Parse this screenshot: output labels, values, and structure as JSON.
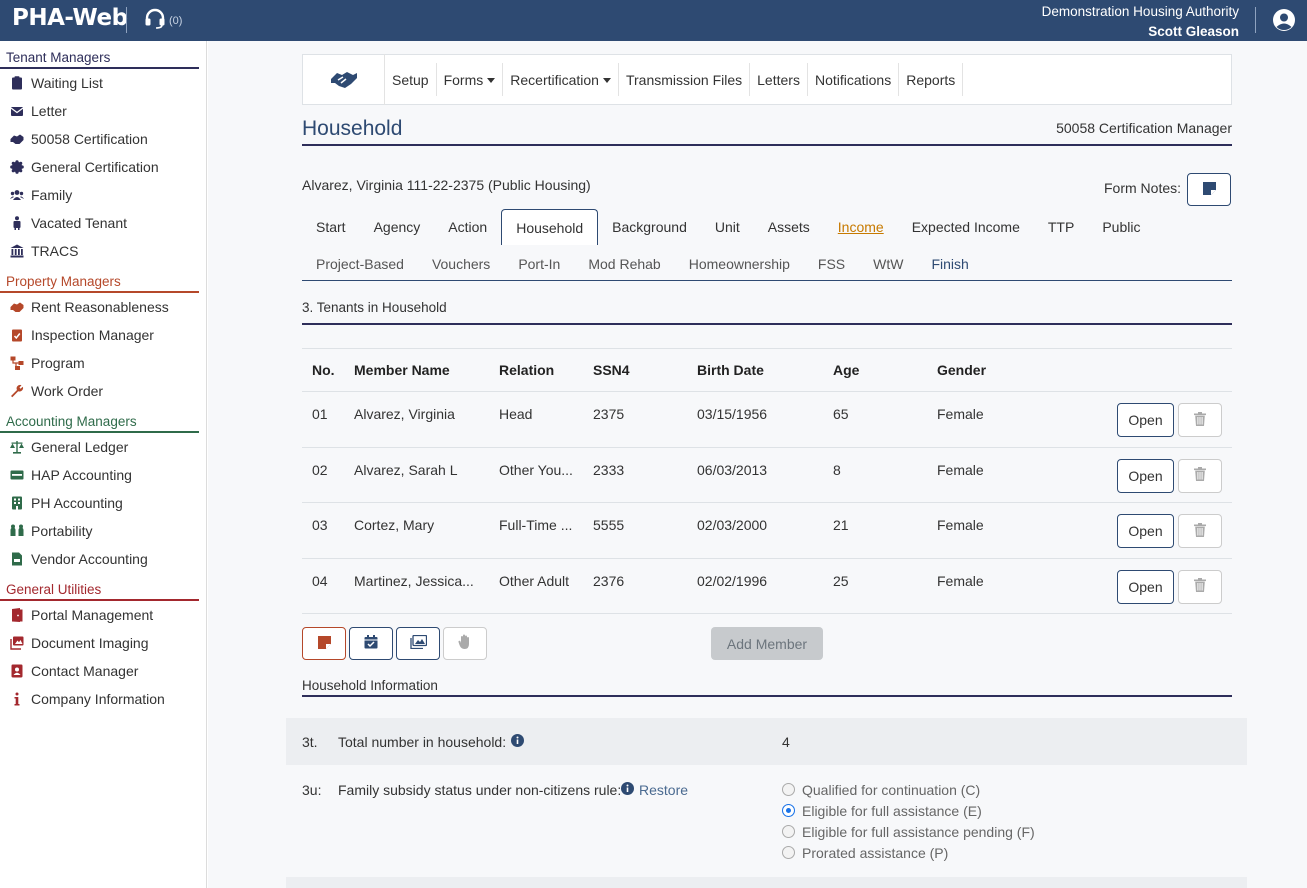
{
  "header": {
    "app_name": "PHA-Web",
    "support_count": "(0)",
    "organization": "Demonstration Housing Authority",
    "user": "Scott Gleason"
  },
  "sidebar": {
    "sections": [
      {
        "title": "Tenant Managers",
        "color": "#2e2e5a",
        "items": [
          {
            "label": "Waiting List",
            "icon": "clipboard-icon"
          },
          {
            "label": "Letter",
            "icon": "envelope-icon"
          },
          {
            "label": "50058 Certification",
            "icon": "handshake-icon"
          },
          {
            "label": "General Certification",
            "icon": "certificate-icon"
          },
          {
            "label": "Family",
            "icon": "users-icon"
          },
          {
            "label": "Vacated Tenant",
            "icon": "person-luggage-icon"
          },
          {
            "label": "TRACS",
            "icon": "building-columns-icon"
          }
        ]
      },
      {
        "title": "Property Managers",
        "color": "#b5482a",
        "items": [
          {
            "label": "Rent Reasonableness",
            "icon": "handshake-icon"
          },
          {
            "label": "Inspection Manager",
            "icon": "clipboard-check-icon"
          },
          {
            "label": "Program",
            "icon": "sitemap-icon"
          },
          {
            "label": "Work Order",
            "icon": "wrench-icon"
          }
        ]
      },
      {
        "title": "Accounting Managers",
        "color": "#2f6b4a",
        "items": [
          {
            "label": "General Ledger",
            "icon": "scale-icon"
          },
          {
            "label": "HAP Accounting",
            "icon": "money-bill-icon"
          },
          {
            "label": "PH Accounting",
            "icon": "building-icon"
          },
          {
            "label": "Portability",
            "icon": "people-arrows-icon"
          },
          {
            "label": "Vendor Accounting",
            "icon": "file-invoice-icon"
          }
        ]
      },
      {
        "title": "General Utilities",
        "color": "#a3282e",
        "items": [
          {
            "label": "Portal Management",
            "icon": "door-icon"
          },
          {
            "label": "Document Imaging",
            "icon": "images-icon"
          },
          {
            "label": "Contact Manager",
            "icon": "address-book-icon"
          },
          {
            "label": "Company Information",
            "icon": "info-icon"
          }
        ]
      }
    ]
  },
  "menubar": {
    "items": [
      {
        "label": "Setup"
      },
      {
        "label": "Forms",
        "dropdown": true
      },
      {
        "label": "Recertification",
        "dropdown": true
      },
      {
        "label": "Transmission Files"
      },
      {
        "label": "Letters"
      },
      {
        "label": "Notifications"
      },
      {
        "label": "Reports"
      }
    ]
  },
  "page": {
    "title": "Household",
    "subtitle": "50058 Certification Manager",
    "tenant": "Alvarez, Virginia 111-22-2375 (Public Housing)",
    "form_notes_label": "Form Notes:"
  },
  "tabs_row1": [
    {
      "label": "Start"
    },
    {
      "label": "Agency"
    },
    {
      "label": "Action"
    },
    {
      "label": "Household",
      "active": true
    },
    {
      "label": "Background"
    },
    {
      "label": "Unit"
    },
    {
      "label": "Assets"
    },
    {
      "label": "Income",
      "warning": true
    },
    {
      "label": "Expected Income"
    },
    {
      "label": "TTP"
    },
    {
      "label": "Public"
    }
  ],
  "tabs_row2": [
    {
      "label": "Project-Based"
    },
    {
      "label": "Vouchers"
    },
    {
      "label": "Port-In"
    },
    {
      "label": "Mod Rehab"
    },
    {
      "label": "Homeownership"
    },
    {
      "label": "FSS"
    },
    {
      "label": "WtW"
    },
    {
      "label": "Finish"
    }
  ],
  "section_title": "3. Tenants in Household",
  "table": {
    "columns": [
      "No.",
      "Member Name",
      "Relation",
      "SSN4",
      "Birth Date",
      "Age",
      "Gender"
    ],
    "rows": [
      [
        "01",
        "Alvarez, Virginia",
        "Head",
        "2375",
        "03/15/1956",
        "65",
        "Female"
      ],
      [
        "02",
        "Alvarez, Sarah L",
        "Other You...",
        "2333",
        "06/03/2013",
        "8",
        "Female"
      ],
      [
        "03",
        "Cortez, Mary",
        "Full-Time ...",
        "5555",
        "02/03/2000",
        "21",
        "Female"
      ],
      [
        "04",
        "Martinez, Jessica...",
        "Other Adult",
        "2376",
        "02/02/1996",
        "25",
        "Female"
      ]
    ],
    "open_label": "Open"
  },
  "actions": {
    "add_member": "Add Member"
  },
  "household_info": {
    "title": "Household Information",
    "field_3t": {
      "code": "3t.",
      "label": "Total number in household:",
      "value": "4"
    },
    "field_3u": {
      "code": "3u:",
      "label": "Family subsidy status under non-citizens rule:",
      "restore": "Restore",
      "options": [
        {
          "label": "Qualified for continuation (C)",
          "selected": false
        },
        {
          "label": "Eligible for full assistance (E)",
          "selected": true
        },
        {
          "label": "Eligible for full assistance pending (F)",
          "selected": false
        },
        {
          "label": "Prorated assistance (P)",
          "selected": false
        }
      ]
    }
  }
}
